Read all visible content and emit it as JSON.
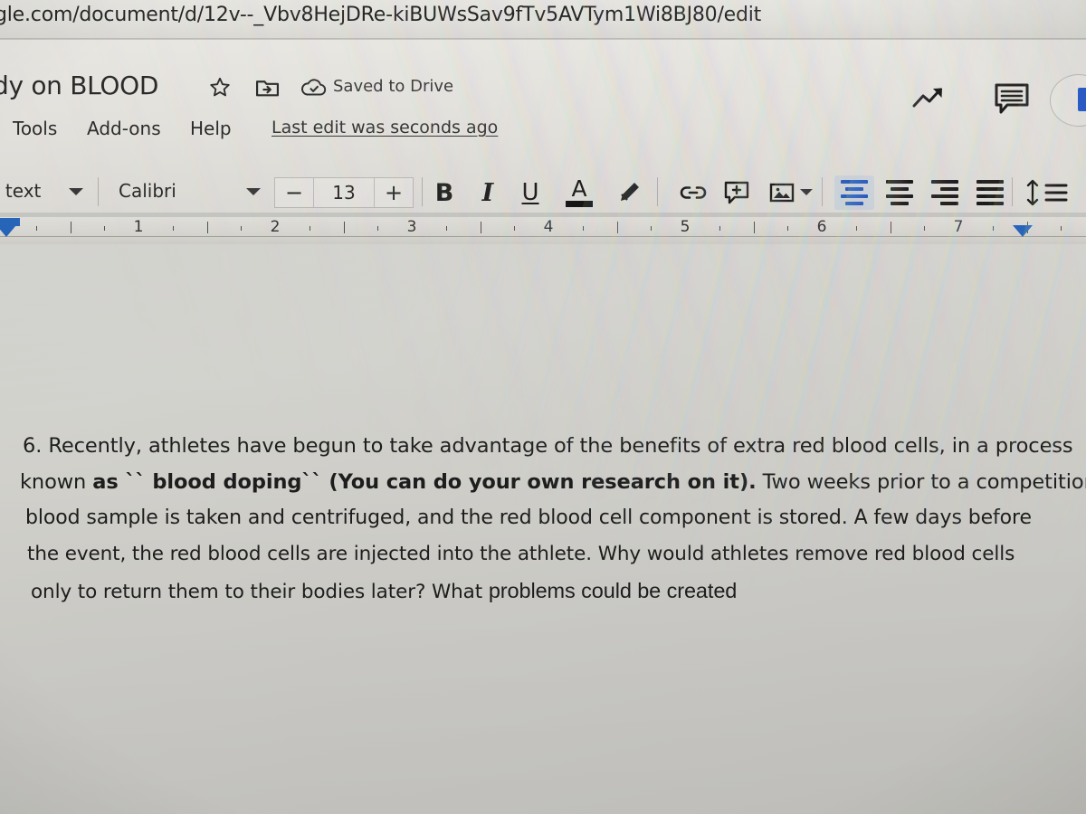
{
  "browser": {
    "url": "gle.com/document/d/12v--_Vbv8HejDRe-kiBUWsSav9fTv5AVTym1Wi8BJ80/edit"
  },
  "header": {
    "doc_title": "dy on BLOOD",
    "star_icon": "star-icon",
    "move_icon": "move-to-folder-icon",
    "cloud_icon": "cloud-check-icon",
    "save_status": "Saved to Drive",
    "last_edit": "Last edit was seconds ago",
    "explore_icon": "trending-up-icon",
    "comments_icon": "comments-icon",
    "share_icon": "share-button"
  },
  "menu": {
    "items": [
      {
        "label": "Tools"
      },
      {
        "label": "Add-ons"
      },
      {
        "label": "Help"
      }
    ]
  },
  "toolbar": {
    "style_label": "l text",
    "font_label": "Calibri",
    "font_size": "13",
    "font_size_minus": "−",
    "font_size_plus": "+",
    "bold_label": "B",
    "italic_label": "I",
    "underline_label": "U",
    "text_color_label": "A",
    "text_color_hex": "#0b0b0b",
    "highlight_icon": "highlight-pen-icon",
    "link_icon": "insert-link-icon",
    "comment_icon": "add-comment-icon",
    "image_icon": "insert-image-icon",
    "align_left_icon": "align-left-icon",
    "align_center_icon": "align-center-icon",
    "align_right_icon": "align-right-icon",
    "align_justify_icon": "align-justify-icon",
    "line_spacing_icon": "line-spacing-icon",
    "active_alignment": "left",
    "active_accent_hex": "#1356c8"
  },
  "ruler": {
    "numbers": [
      "1",
      "2",
      "3",
      "4",
      "5",
      "6",
      "7"
    ],
    "left_indent_marker": "left-indent-marker",
    "right_indent_marker": "right-indent-marker",
    "marker_color_hex": "#1862c5"
  },
  "document": {
    "lines": [
      {
        "id": "line1",
        "segments": [
          {
            "text": "6. Recently, athletes have begun to take advantage of the benefits of extra red blood cells, in a process",
            "bold": false
          }
        ]
      },
      {
        "id": "line2",
        "segments": [
          {
            "text": "known ",
            "bold": false
          },
          {
            "text": "as `` blood doping`` (You can do your own research on it).",
            "bold": true
          },
          {
            "text": " Two weeks prior to a competition, a",
            "bold": false
          }
        ]
      },
      {
        "id": "line3",
        "segments": [
          {
            "text": "blood sample is taken and centrifuged, and the red blood cell component is stored. A few days before",
            "bold": false
          }
        ]
      },
      {
        "id": "line4",
        "segments": [
          {
            "text": "the event, the red blood cells are injected into the athlete. Why would athletes remove red blood cells",
            "bold": false
          }
        ]
      },
      {
        "id": "line5",
        "segments": [
          {
            "text": "only to return them to their bodies later? What ",
            "bold": false
          },
          {
            "text": "problems could be created",
            "bold": false,
            "bigger": true
          }
        ]
      }
    ]
  }
}
